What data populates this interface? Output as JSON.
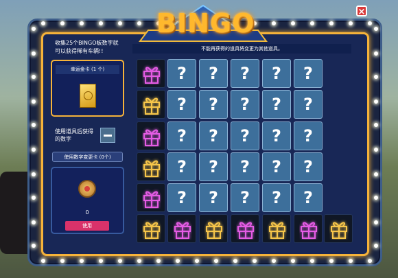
{
  "title": "BINGO",
  "close_icon": "close-icon",
  "description": "收集25个BINGO板数字就可以获得稀有车辆!!",
  "lucky_card": {
    "label": "幸运金卡 (1 个)",
    "icon": "gold-card-icon"
  },
  "use_item": {
    "label": "使用道具后获得的数字",
    "button_icon": "minus-icon"
  },
  "change_card_button": "使用数字变更卡 (0个)",
  "use_panel": {
    "count": "0",
    "button": "使用",
    "icon": "coin-token-icon"
  },
  "note": "不能再获得的道具将变更为其他道具。",
  "grid": {
    "row_gifts": [
      "pink",
      "gold",
      "pink",
      "gold",
      "pink"
    ],
    "bottom_gifts": [
      "gold",
      "pink",
      "gold",
      "pink",
      "gold",
      "pink",
      "gold"
    ],
    "question_mark": "?"
  },
  "colors": {
    "gold": "#f7c64a",
    "pink": "#e55ce5",
    "frame": "#f6b33a"
  }
}
